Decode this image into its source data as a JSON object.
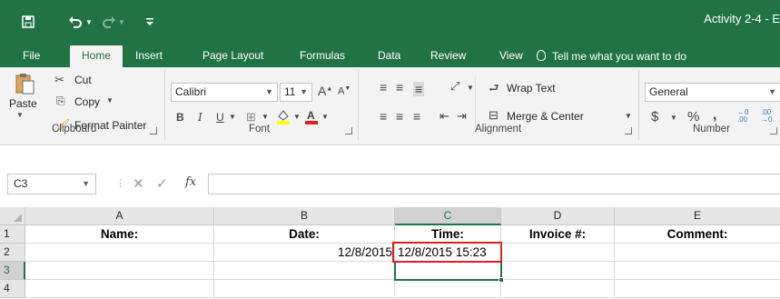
{
  "window": {
    "title": "Activity 2-4 - E"
  },
  "quick_access": {
    "save_icon": "save-icon",
    "undo_icon": "undo-icon",
    "redo_icon": "redo-icon",
    "customize_icon": "customize-qat-icon"
  },
  "tabs": [
    {
      "label": "File"
    },
    {
      "label": "Home"
    },
    {
      "label": "Insert"
    },
    {
      "label": "Page Layout"
    },
    {
      "label": "Formulas"
    },
    {
      "label": "Data"
    },
    {
      "label": "Review"
    },
    {
      "label": "View"
    }
  ],
  "tell_me": "Tell me what you want to do",
  "ribbon": {
    "clipboard": {
      "label": "Clipboard",
      "paste": "Paste",
      "cut": "Cut",
      "copy": "Copy",
      "format_painter": "Format Painter"
    },
    "font": {
      "label": "Font",
      "font_name": "Calibri",
      "font_size": "11"
    },
    "alignment": {
      "label": "Alignment",
      "wrap_text": "Wrap Text",
      "merge_center": "Merge & Center"
    },
    "number": {
      "label": "Number",
      "format": "General",
      "currency": "$",
      "percent": "%",
      "comma": ","
    }
  },
  "formula_bar": {
    "name_box": "C3",
    "fx": "fx",
    "formula": ""
  },
  "sheet": {
    "columns": [
      "A",
      "B",
      "C",
      "D",
      "E"
    ],
    "rows": [
      "1",
      "2",
      "3",
      "4"
    ],
    "cells": {
      "A1": "Name:",
      "B1": "Date:",
      "C1": "Time:",
      "D1": "Invoice #:",
      "E1": "Comment:",
      "B2": "12/8/2015",
      "C2": "12/8/2015 15:23"
    },
    "selected_cell": "C3"
  },
  "colors": {
    "excel_green": "#217346",
    "highlight_red": "#e01e1e"
  }
}
